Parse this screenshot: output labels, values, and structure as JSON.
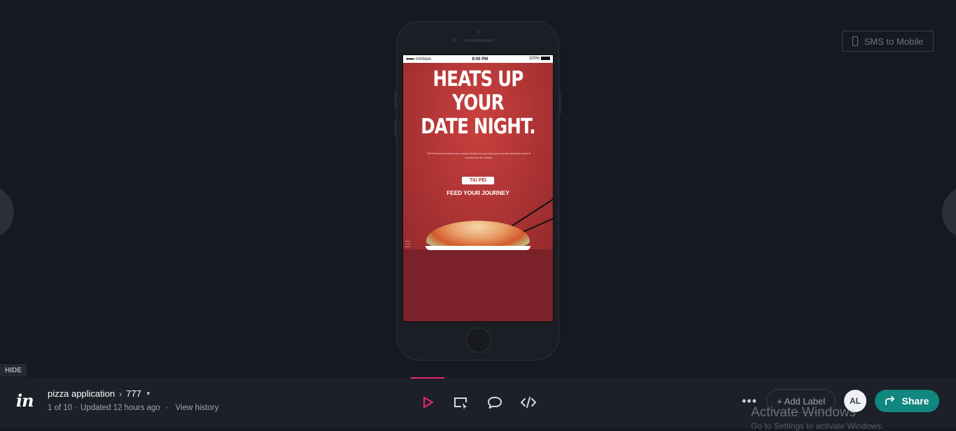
{
  "sms_button": {
    "label": "SMS to Mobile",
    "icon": "mobile-phone-icon"
  },
  "navigation": {
    "prev_icon": "chevron-left-icon",
    "next_icon": "chevron-right-icon"
  },
  "device": {
    "status_bar": {
      "carrier": "InVision",
      "time": "8:00 PM",
      "battery": "100%"
    },
    "ad": {
      "headline_lines": [
        "HEATS UP",
        "YOUR",
        "DATE NIGHT."
      ],
      "subcopy": "Tai Pei frozen entrees are a tasty solution for you and your special someone when it comes time for dinner.",
      "brand": "TAI PEI",
      "tagline": "FEED YOUR JOURNEY"
    }
  },
  "hide_tab": {
    "label": "HIDE"
  },
  "toolbar": {
    "logo": "in",
    "project_name": "pizza application",
    "screen_name": "777",
    "meta": {
      "position": "1 of 10",
      "updated": "Updated 12 hours ago",
      "history_link": "View history"
    },
    "modes": [
      {
        "name": "preview",
        "icon": "play-icon",
        "active": true
      },
      {
        "name": "build",
        "icon": "cursor-box-icon"
      },
      {
        "name": "comment",
        "icon": "comment-icon"
      },
      {
        "name": "inspect",
        "icon": "code-icon"
      }
    ],
    "add_label": "+ Add Label",
    "avatar_initials": "AL",
    "share_label": "Share",
    "accent_color": "#e5276d",
    "share_color": "#12877f"
  },
  "watermark": {
    "title": "Activate Windows",
    "subtitle": "Go to Settings to activate Windows."
  }
}
